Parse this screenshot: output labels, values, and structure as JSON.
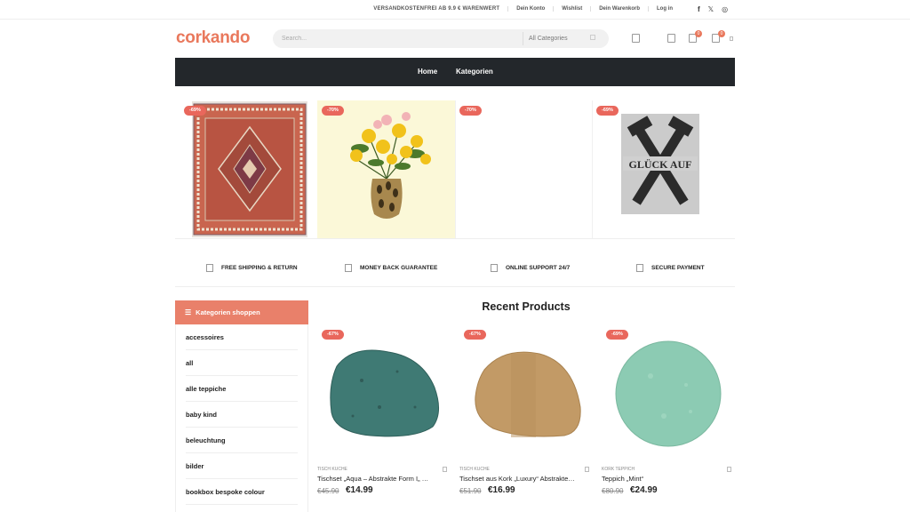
{
  "topbar": {
    "promo": "VERSANDKOSTENFREI AB 9.9 € WARENWERT",
    "account": "Dein Konto",
    "wishlist": "Wishlist",
    "cart": "Dein Warenkorb",
    "login": "Log in",
    "social": [
      "f",
      "𝕏",
      "◎"
    ]
  },
  "header": {
    "logo": "corkando",
    "search_placeholder": "Search...",
    "category_select": "All Categories",
    "wishlist_count": "0",
    "cart_count": "0"
  },
  "nav": {
    "items": [
      "Home",
      "Kategorien"
    ]
  },
  "banner": {
    "discounts": [
      "-69%",
      "-70%",
      "-70%",
      "-69%"
    ],
    "sign_text": "GLÜCK AUF"
  },
  "features": [
    "FREE SHIPPING & RETURN",
    "MONEY BACK GUARANTEE",
    "ONLINE SUPPORT 24/7",
    "SECURE PAYMENT"
  ],
  "sidebar": {
    "title": "Kategorien shoppen",
    "items": [
      "accessoires",
      "all",
      "alle teppiche",
      "baby kind",
      "beleuchtung",
      "bilder",
      "bookbox bespoke colour"
    ]
  },
  "recent": {
    "title": "Recent Products",
    "products": [
      {
        "discount": "-67%",
        "category": "TISCH KUCHE",
        "name": "Tischset „Aqua – Abstrakte Form I„ …",
        "old_price": "€45.90",
        "price": "€14.99"
      },
      {
        "discount": "-67%",
        "category": "TISCH KUCHE",
        "name": "Tischset aus Kork „Luxury“ Abstrakte…",
        "old_price": "€51.90",
        "price": "€16.99"
      },
      {
        "discount": "-69%",
        "category": "KORK TEPPICH",
        "name": "Teppich „Mint“",
        "old_price": "€80.90",
        "price": "€24.99"
      }
    ]
  },
  "colors": {
    "brand": "#e9785c",
    "nav_bg": "#23272b",
    "sale_badge": "#e9675c"
  }
}
